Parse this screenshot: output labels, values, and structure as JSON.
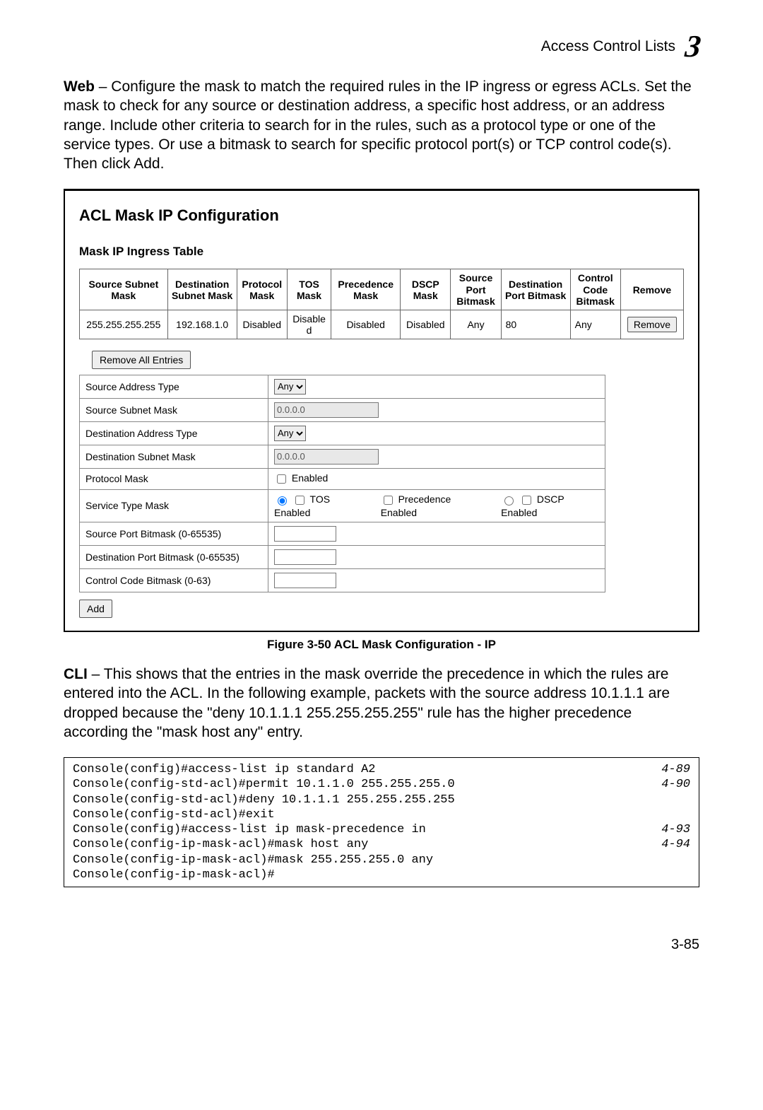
{
  "header": {
    "section": "Access Control Lists",
    "chapter": "3"
  },
  "web_para": "<b>Web</b> – Configure the mask to match the required rules in the IP ingress or egress ACLs. Set the mask to check for any source or destination address, a specific host address, or an address range. Include other criteria to search for in the rules, such as a protocol type or one of the service types. Or use a bitmask to search for specific protocol port(s) or TCP control code(s). Then click Add.",
  "figure": {
    "title": "ACL Mask IP Configuration",
    "table_heading": "Mask IP Ingress Table",
    "columns": [
      "Source Subnet Mask",
      "Destination Subnet Mask",
      "Protocol Mask",
      "TOS Mask",
      "Precedence Mask",
      "DSCP Mask",
      "Source Port Bitmask",
      "Destination Port Bitmask",
      "Control Code Bitmask",
      "Remove"
    ],
    "row": {
      "src": "255.255.255.255",
      "dst": "192.168.1.0",
      "proto": "Disabled",
      "tos": "Disabled",
      "prec": "Disabled",
      "dscp": "Disabled",
      "sport": "Any",
      "dport": "80",
      "ccode": "Any",
      "remove": "Remove"
    },
    "remove_all": "Remove All Entries",
    "form": {
      "src_addr_type": {
        "label": "Source Address Type",
        "value": "Any"
      },
      "src_subnet": {
        "label": "Source Subnet Mask",
        "value": "0.0.0.0"
      },
      "dst_addr_type": {
        "label": "Destination Address Type",
        "value": "Any"
      },
      "dst_subnet": {
        "label": "Destination Subnet Mask",
        "value": "0.0.0.0"
      },
      "proto_mask": {
        "label": "Protocol Mask",
        "option": "Enabled"
      },
      "service_type": {
        "label": "Service Type Mask",
        "tos": "TOS Enabled",
        "prec": "Precedence Enabled",
        "dscp": "DSCP Enabled"
      },
      "sport_bitmask": {
        "label": "Source Port Bitmask (0-65535)",
        "value": ""
      },
      "dport_bitmask": {
        "label": "Destination Port Bitmask (0-65535)",
        "value": ""
      },
      "ccode_bitmask": {
        "label": "Control Code Bitmask (0-63)",
        "value": ""
      }
    },
    "add_btn": "Add",
    "caption": "Figure 3-50   ACL Mask Configuration - IP"
  },
  "cli_para": "<b>CLI</b> – This shows that the entries in the mask override the precedence in which the rules are entered into the ACL. In the following example, packets with the source address 10.1.1.1 are dropped because the \"deny 10.1.1.1 255.255.255.255\" rule has the higher precedence according the \"mask host any\" entry.",
  "console": {
    "lines": [
      {
        "text": "Console(config)#access-list ip standard A2",
        "ref": "4-89"
      },
      {
        "text": "Console(config-std-acl)#permit 10.1.1.0 255.255.255.0",
        "ref": "4-90"
      },
      {
        "text": "Console(config-std-acl)#deny 10.1.1.1 255.255.255.255",
        "ref": ""
      },
      {
        "text": "Console(config-std-acl)#exit",
        "ref": ""
      },
      {
        "text": "Console(config)#access-list ip mask-precedence in",
        "ref": "4-93"
      },
      {
        "text": "Console(config-ip-mask-acl)#mask host any",
        "ref": "4-94"
      },
      {
        "text": "Console(config-ip-mask-acl)#mask 255.255.255.0 any",
        "ref": ""
      },
      {
        "text": "Console(config-ip-mask-acl)#",
        "ref": ""
      }
    ]
  },
  "page_number": "3-85"
}
